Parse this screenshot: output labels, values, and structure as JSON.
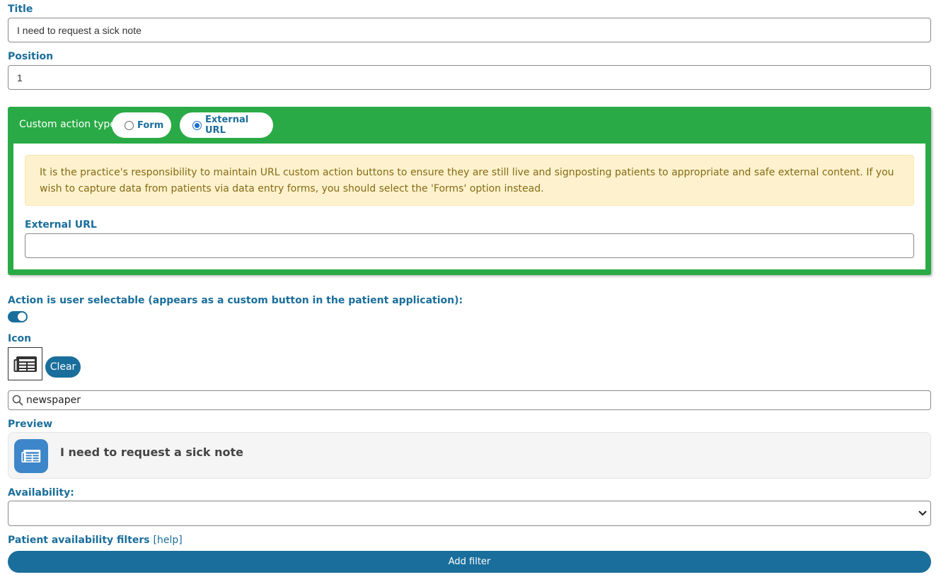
{
  "title_field": {
    "label": "Title",
    "value": "I need to request a sick note"
  },
  "position_field": {
    "label": "Position",
    "value": "1"
  },
  "custom_action": {
    "type_label": "Custom action type:",
    "options": [
      {
        "label": "Form",
        "selected": false
      },
      {
        "label": "External URL",
        "selected": true
      }
    ],
    "warning": "It is the practice's responsibility to maintain URL custom action buttons to ensure they are still live and signposting patients to appropriate and safe external content. If you wish to capture data from patients via data entry forms, you should select the 'Forms' option instead.",
    "external_url_label": "External URL",
    "external_url_value": "",
    "panel_color": "#2aaa46"
  },
  "user_selectable": {
    "label": "Action is user selectable (appears as a custom button in the patient application):",
    "enabled": true
  },
  "icon": {
    "label": "Icon",
    "icon_name": "newspaper-icon",
    "clear_label": "Clear"
  },
  "icon_search": {
    "value": "newspaper"
  },
  "preview": {
    "label": "Preview",
    "title": "I need to request a sick note",
    "icon_name": "newspaper-icon",
    "icon_bg": "#3d86c9"
  },
  "availability": {
    "label": "Availability:",
    "selected": ""
  },
  "filters": {
    "label": "Patient availability filters",
    "help_label": "[help]",
    "add_label": "Add filter"
  },
  "accent_color": "#1a6e9b"
}
